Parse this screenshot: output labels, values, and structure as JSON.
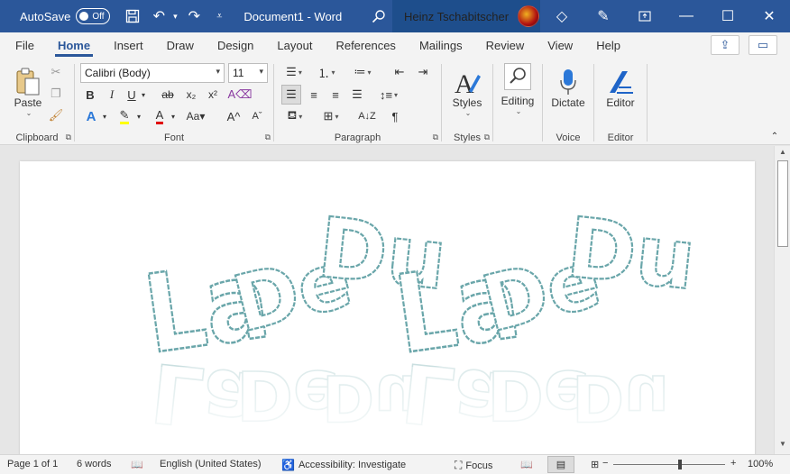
{
  "title_bar": {
    "autosave_label": "AutoSave",
    "autosave_state": "Off",
    "document_title": "Document1  -  Word",
    "user_name": "Heinz Tschabitscher"
  },
  "tabs": [
    "File",
    "Home",
    "Insert",
    "Draw",
    "Design",
    "Layout",
    "References",
    "Mailings",
    "Review",
    "View",
    "Help"
  ],
  "active_tab": "Home",
  "ribbon": {
    "clipboard": {
      "label": "Clipboard",
      "paste_label": "Paste"
    },
    "font": {
      "label": "Font",
      "font_name": "Calibri (Body)",
      "font_size": "11"
    },
    "paragraph": {
      "label": "Paragraph"
    },
    "styles": {
      "label": "Styles",
      "styles_button": "Styles"
    },
    "editing": {
      "editing_button": "Editing"
    },
    "voice": {
      "label": "Voice",
      "dictate_button": "Dictate"
    },
    "editor": {
      "label": "Editor",
      "editor_button": "Editor"
    }
  },
  "document": {
    "wordart_text": "La De Du La De Du",
    "wordart_words": [
      "La",
      "De",
      "Du",
      "La",
      "De",
      "Du"
    ],
    "outline_color": "#5aa0a4"
  },
  "status_bar": {
    "page": "Page 1 of 1",
    "words": "6 words",
    "language": "English (United States)",
    "accessibility": "Accessibility: Investigate",
    "focus": "Focus",
    "zoom": "100%"
  },
  "colors": {
    "title_bar": "#2b579a",
    "accent": "#2b579a",
    "highlight": "#ffff00",
    "font_color": "#e00000"
  }
}
